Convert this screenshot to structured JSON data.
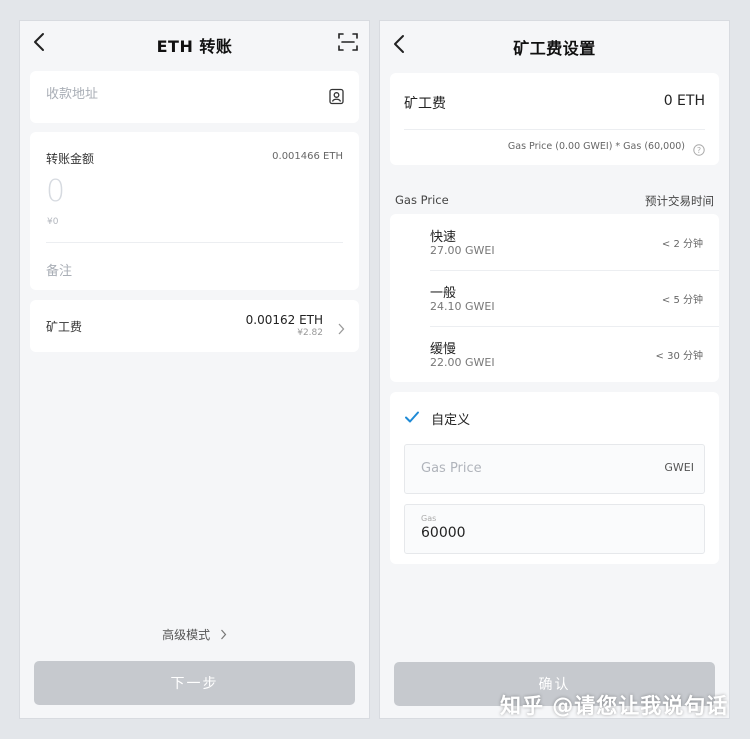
{
  "colors": {
    "accent": "#1f8ad6",
    "button_disabled": "#c6c9ce",
    "background": "#f5f6f8"
  },
  "left": {
    "title": "ETH 转账",
    "address": {
      "placeholder": "收款地址",
      "value": ""
    },
    "amount": {
      "label": "转账金额",
      "balance": "0.001466 ETH",
      "value": "0",
      "fiat": "¥0",
      "note_placeholder": "备注"
    },
    "fee": {
      "label": "矿工费",
      "eth": "0.00162 ETH",
      "fiat": "¥2.82"
    },
    "advanced_mode": "高级模式",
    "next_button": "下一步"
  },
  "right": {
    "title": "矿工费设置",
    "fee": {
      "label": "矿工费",
      "value": "0 ETH",
      "formula": "Gas Price (0.00 GWEI) * Gas (60,000)"
    },
    "gas_price_header": "Gas Price",
    "estimated_time_header": "预计交易时间",
    "speeds": [
      {
        "name": "快速",
        "price": "27.00 GWEI",
        "time": "< 2 分钟"
      },
      {
        "name": "一般",
        "price": "24.10 GWEI",
        "time": "< 5 分钟"
      },
      {
        "name": "缓慢",
        "price": "22.00 GWEI",
        "time": "< 30 分钟"
      }
    ],
    "custom": {
      "label": "自定义",
      "gas_price_placeholder": "Gas Price",
      "gas_price_unit": "GWEI",
      "gas_label": "Gas",
      "gas_value": "60000"
    },
    "confirm_button": "确认"
  },
  "watermark": "知乎 @请您让我说句话"
}
